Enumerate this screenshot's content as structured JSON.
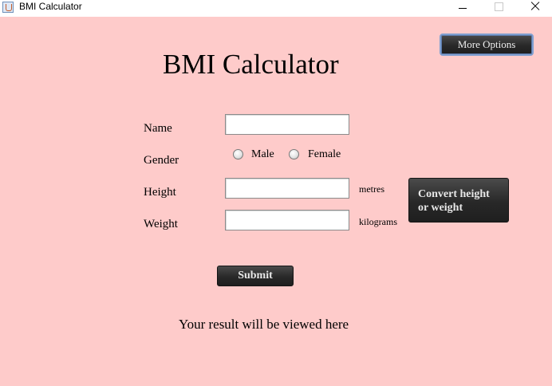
{
  "window": {
    "title": "BMI Calculator"
  },
  "header": {
    "title": "BMI Calculator",
    "more_options": "More Options"
  },
  "form": {
    "name_label": "Name",
    "name_value": "",
    "gender_label": "Gender",
    "gender_options": [
      "Male",
      "Female"
    ],
    "gender_selected": "",
    "height_label": "Height",
    "height_value": "",
    "height_unit": "metres",
    "weight_label": "Weight",
    "weight_value": "",
    "weight_unit": "kilograms",
    "convert_button_line1": "Convert height",
    "convert_button_line2": "or weight",
    "submit_label": "Submit"
  },
  "result": {
    "text": "Your result will be viewed here"
  }
}
